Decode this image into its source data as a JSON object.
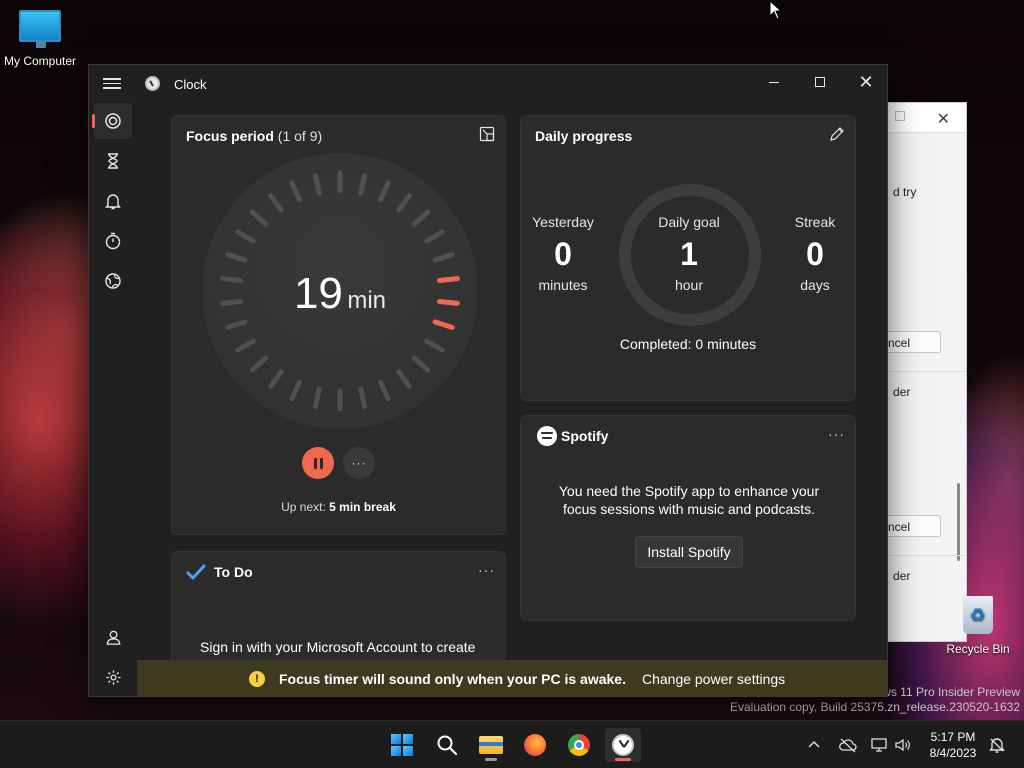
{
  "desktop": {
    "my_computer_label": "My Computer",
    "recycle_bin_label": "Recycle Bin",
    "watermark_line1": "ws 11 Pro Insider Preview",
    "watermark_line2": "Evaluation copy. Build 25375.zn_release.230520-1632"
  },
  "background_window": {
    "text1": "d try",
    "button1": "ncel",
    "text2": "der",
    "button2": "ncel",
    "text3": "der"
  },
  "window": {
    "title": "Clock"
  },
  "sidebar": {
    "items": [
      {
        "name": "focus-sessions-icon",
        "active": true
      },
      {
        "name": "timer-icon",
        "active": false
      },
      {
        "name": "alarm-icon",
        "active": false
      },
      {
        "name": "stopwatch-icon",
        "active": false
      },
      {
        "name": "world-clock-icon",
        "active": false
      }
    ],
    "bottom": [
      {
        "name": "account-icon"
      },
      {
        "name": "settings-icon"
      }
    ]
  },
  "focus": {
    "title": "Focus period",
    "count": "(1 of 9)",
    "minutes": "19",
    "unit": "min",
    "up_next_prefix": "Up next:",
    "up_next_value": "5 min break",
    "more_label": "···"
  },
  "progress": {
    "title": "Daily progress",
    "yesterday_label": "Yesterday",
    "yesterday_value": "0",
    "yesterday_unit": "minutes",
    "goal_label": "Daily goal",
    "goal_value": "1",
    "goal_unit": "hour",
    "streak_label": "Streak",
    "streak_value": "0",
    "streak_unit": "days",
    "completed": "Completed: 0 minutes"
  },
  "spotify": {
    "brand": "Spotify",
    "message": "You need the Spotify app to enhance your focus sessions with music and podcasts.",
    "install_label": "Install Spotify",
    "more_label": "···"
  },
  "todo": {
    "title": "To Do",
    "message": "Sign in with your Microsoft Account to create",
    "more_label": "···"
  },
  "notification": {
    "message": "Focus timer will sound only when your PC is awake.",
    "link": "Change power settings"
  },
  "taskbar": {
    "time": "5:17 PM",
    "date": "8/4/2023"
  },
  "colors": {
    "accent": "#f0694f",
    "notification_bg": "#3e3a1f",
    "warning": "#f4d03f"
  }
}
